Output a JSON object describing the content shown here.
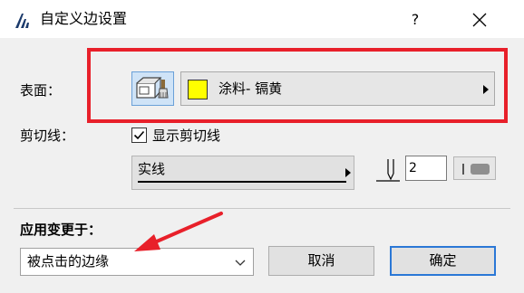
{
  "window": {
    "title": "自定义边设置",
    "help_label": "?",
    "accent_color": "#2b78d6",
    "highlight_color": "#e8202a"
  },
  "surface": {
    "label": "表面：",
    "button_icon": "surface-paint-icon",
    "material_name": "涂料- 镉黄",
    "swatch_color": "#ffff00"
  },
  "cutline": {
    "label": "剪切线：",
    "show_checked": true,
    "show_label": "显示剪切线",
    "line_type": "实线",
    "pen_number": "2"
  },
  "apply": {
    "label": "应用变更于：",
    "selected": "被点击的边缘"
  },
  "buttons": {
    "cancel": "取消",
    "ok": "确定"
  }
}
